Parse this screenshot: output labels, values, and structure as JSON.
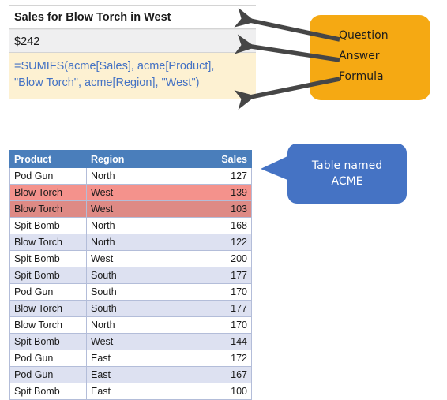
{
  "question": {
    "label": "Sales for Blow Torch in West"
  },
  "answer": {
    "value": "$242"
  },
  "formula": {
    "line1": "=SUMIFS(acme[Sales], acme[Product],",
    "line2": "\"Blow Torch\", acme[Region], \"West\")"
  },
  "callouts": {
    "orange": {
      "items": [
        {
          "label": "Question"
        },
        {
          "label": "Answer"
        },
        {
          "label": "Formula"
        }
      ],
      "color": "#f5a913"
    },
    "blue": {
      "line1": "Table named",
      "line2": "ACME",
      "color": "#4573c4"
    },
    "arrow_color": "#464646"
  },
  "table": {
    "columns": [
      "Product",
      "Region",
      "Sales"
    ],
    "header_color": "#4a7ebb",
    "band_color": "#dde1f1",
    "highlight_colors": [
      "#f4928c",
      "#de8a85"
    ],
    "rows": [
      {
        "product": "Pod Gun",
        "region": "North",
        "sales": "127",
        "style": "row-white"
      },
      {
        "product": "Blow Torch",
        "region": "West",
        "sales": "139",
        "style": "row-hi-a"
      },
      {
        "product": "Blow Torch",
        "region": "West",
        "sales": "103",
        "style": "row-hi-b"
      },
      {
        "product": "Spit Bomb",
        "region": "North",
        "sales": "168",
        "style": "row-white"
      },
      {
        "product": "Blow Torch",
        "region": "North",
        "sales": "122",
        "style": "row-band"
      },
      {
        "product": "Spit Bomb",
        "region": "West",
        "sales": "200",
        "style": "row-white"
      },
      {
        "product": "Spit Bomb",
        "region": "South",
        "sales": "177",
        "style": "row-band"
      },
      {
        "product": "Pod Gun",
        "region": "South",
        "sales": "170",
        "style": "row-white"
      },
      {
        "product": "Blow Torch",
        "region": "South",
        "sales": "177",
        "style": "row-band"
      },
      {
        "product": "Blow Torch",
        "region": "North",
        "sales": "170",
        "style": "row-white"
      },
      {
        "product": "Spit Bomb",
        "region": "West",
        "sales": "144",
        "style": "row-band"
      },
      {
        "product": "Pod Gun",
        "region": "East",
        "sales": "172",
        "style": "row-white"
      },
      {
        "product": "Pod Gun",
        "region": "East",
        "sales": "167",
        "style": "row-band"
      },
      {
        "product": "Spit Bomb",
        "region": "East",
        "sales": "100",
        "style": "row-white"
      }
    ]
  }
}
